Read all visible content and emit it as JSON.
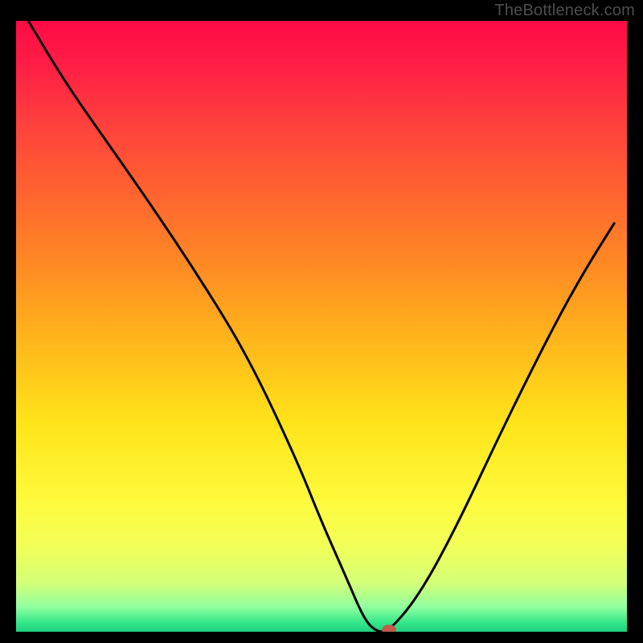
{
  "watermark": "TheBottleneck.com",
  "colors": {
    "page_bg": "#000000",
    "watermark_text": "#4e4e4e",
    "curve_stroke": "#000000",
    "marker_fill": "#c35a4a"
  },
  "chart_data": {
    "type": "line",
    "title": "",
    "xlabel": "",
    "ylabel": "",
    "xlim": [
      0,
      100
    ],
    "ylim": [
      0,
      100
    ],
    "annotations": [],
    "series": [
      {
        "name": "bottleneck-curve",
        "x": [
          2,
          8,
          15,
          22,
          30,
          38,
          46,
          50,
          54,
          57,
          59,
          61,
          66,
          72,
          80,
          88,
          93,
          98
        ],
        "values": [
          100,
          90,
          80,
          70,
          58,
          45,
          28,
          18,
          9,
          2,
          0,
          0,
          6,
          17,
          34,
          50,
          59,
          67
        ]
      }
    ],
    "marker": {
      "x": 61,
      "y": 0
    },
    "gradient_stops": [
      {
        "pos": 0.0,
        "color": "#ff0b46"
      },
      {
        "pos": 0.07,
        "color": "#ff1d45"
      },
      {
        "pos": 0.15,
        "color": "#ff3a3f"
      },
      {
        "pos": 0.28,
        "color": "#ff6330"
      },
      {
        "pos": 0.4,
        "color": "#ff8a24"
      },
      {
        "pos": 0.52,
        "color": "#ffb51b"
      },
      {
        "pos": 0.66,
        "color": "#ffe41a"
      },
      {
        "pos": 0.78,
        "color": "#fff93a"
      },
      {
        "pos": 0.86,
        "color": "#f2ff58"
      },
      {
        "pos": 0.92,
        "color": "#d4ff77"
      },
      {
        "pos": 0.96,
        "color": "#8fffa0"
      },
      {
        "pos": 0.985,
        "color": "#34e78a"
      },
      {
        "pos": 1.0,
        "color": "#1fcf7d"
      }
    ]
  }
}
